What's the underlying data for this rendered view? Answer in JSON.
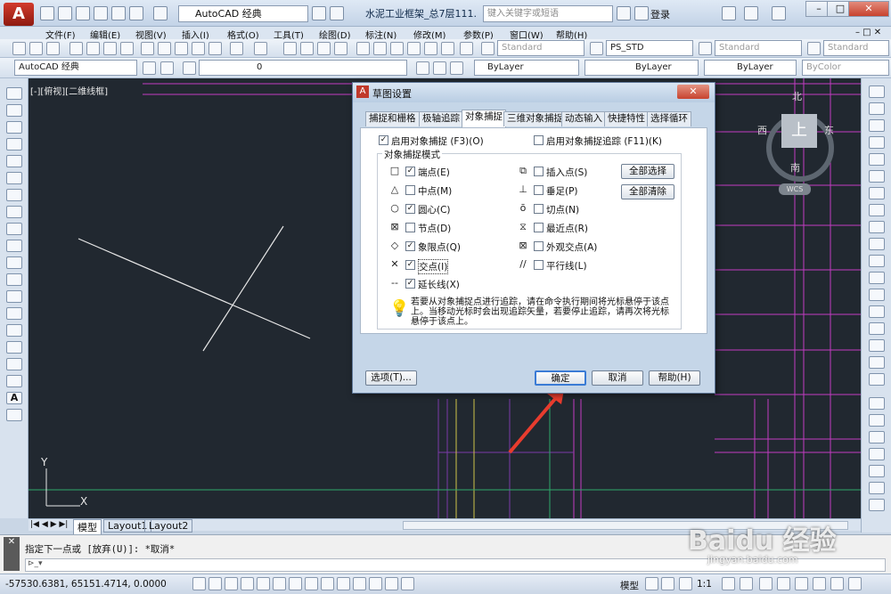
{
  "app": {
    "logo": "A",
    "workspace": "AutoCAD 经典",
    "window_title": "水泥工业框架_总7层111....",
    "search_placeholder": "键入关键字或短语",
    "login": "登录"
  },
  "menu": [
    "文件(F)",
    "编辑(E)",
    "视图(V)",
    "插入(I)",
    "格式(O)",
    "工具(T)",
    "绘图(D)",
    "标注(N)",
    "修改(M)",
    "参数(P)",
    "窗口(W)",
    "帮助(H)"
  ],
  "toolbar": {
    "text_style": "Standard",
    "dim_style": "PS_STD",
    "table_style": "Standard",
    "multileader_style": "Standard",
    "workspace2": "AutoCAD 经典",
    "layer": "0",
    "color": "ByLayer",
    "linetype": "ByLayer",
    "lineweight": "ByLayer",
    "plotstyle": "ByColor"
  },
  "viewport": {
    "label": "[-][俯视][二维线框]",
    "compass": {
      "north": "北",
      "south": "南",
      "east": "东",
      "west": "西",
      "top": "上",
      "wcs": "WCS"
    },
    "ucs_y": "Y",
    "ucs_x": "X"
  },
  "layout_tabs": [
    "模型",
    "Layout1",
    "Layout2"
  ],
  "command": {
    "history": "指定下一点或 [放弃(U)]: *取消*",
    "prompt": ""
  },
  "status": {
    "coords": "-57530.6381, 65151.4714, 0.0000",
    "model": "模型",
    "scale": "1:1"
  },
  "dialog": {
    "title": "草图设置",
    "tabs": [
      "捕捉和栅格",
      "极轴追踪",
      "对象捕捉",
      "三维对象捕捉",
      "动态输入",
      "快捷特性",
      "选择循环"
    ],
    "active_tab": 2,
    "enable_osnap": "启用对象捕捉 (F3)(O)",
    "enable_tracking": "启用对象捕捉追踪 (F11)(K)",
    "group_label": "对象捕捉模式",
    "left_modes": [
      {
        "sym": "□",
        "label": "端点(E)",
        "checked": true
      },
      {
        "sym": "△",
        "label": "中点(M)",
        "checked": false
      },
      {
        "sym": "○",
        "label": "圆心(C)",
        "checked": true
      },
      {
        "sym": "⊠",
        "label": "节点(D)",
        "checked": false
      },
      {
        "sym": "◇",
        "label": "象限点(Q)",
        "checked": true
      },
      {
        "sym": "✕",
        "label": "交点(I)",
        "checked": true
      },
      {
        "sym": "--",
        "label": "延长线(X)",
        "checked": true
      }
    ],
    "right_modes": [
      {
        "sym": "⧉",
        "label": "插入点(S)",
        "checked": false
      },
      {
        "sym": "⊥",
        "label": "垂足(P)",
        "checked": false
      },
      {
        "sym": "ō",
        "label": "切点(N)",
        "checked": false
      },
      {
        "sym": "⧖",
        "label": "最近点(R)",
        "checked": false
      },
      {
        "sym": "⊠",
        "label": "外观交点(A)",
        "checked": false
      },
      {
        "sym": "//",
        "label": "平行线(L)",
        "checked": false
      }
    ],
    "select_all": "全部选择",
    "clear_all": "全部清除",
    "hint": "若要从对象捕捉点进行追踪，请在命令执行期间将光标悬停于该点上。当移动光标时会出现追踪矢量，若要停止追踪，请再次将光标悬停于该点上。",
    "options_btn": "选项(T)...",
    "ok_btn": "确定",
    "cancel_btn": "取消",
    "help_btn": "帮助(H)"
  },
  "watermark": {
    "brand": "Baidu 经验",
    "url": "jingyan.baidu.com"
  }
}
